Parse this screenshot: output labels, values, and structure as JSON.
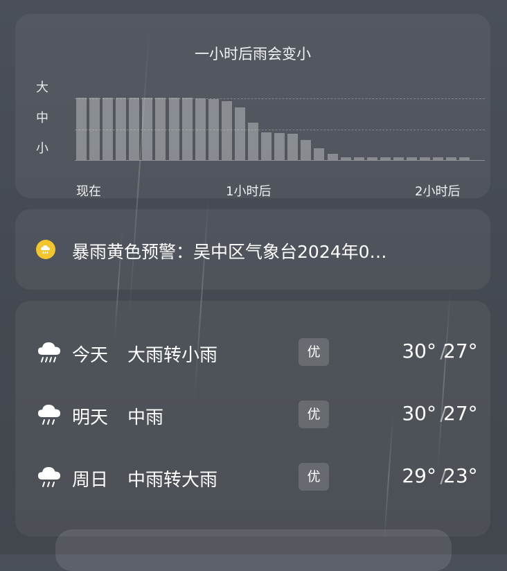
{
  "colors": {
    "background": "#474c54",
    "alert_icon": "#f3c62f",
    "bar": "rgba(255,255,255,0.32)"
  },
  "rain_card": {
    "title": "一小时后雨会变小",
    "levels": {
      "high": "大",
      "mid": "中",
      "low": "小"
    },
    "x_labels": {
      "now": "现在",
      "one_hour": "1小时后",
      "two_hours": "2小时后"
    }
  },
  "chart_data": {
    "type": "bar",
    "title": "一小时后雨会变小",
    "y_scale": [
      "小",
      "中",
      "大"
    ],
    "ylim": [
      0,
      3
    ],
    "x_tick_labels": [
      "现在",
      "1小时后",
      "2小时后"
    ],
    "values": [
      2.0,
      2.0,
      2.0,
      2.0,
      2.0,
      2.0,
      2.0,
      2.0,
      2.0,
      1.98,
      1.95,
      1.9,
      1.7,
      1.2,
      0.88,
      0.86,
      0.84,
      0.65,
      0.38,
      0.2,
      0.1,
      0.1,
      0.1,
      0.1,
      0.1,
      0.1,
      0.1,
      0.1,
      0.1,
      0.1
    ],
    "grid": true
  },
  "alert": {
    "icon": "storm-warning-icon",
    "text": "暴雨黄色预警：吴中区气象台2024年0…"
  },
  "forecast": [
    {
      "day": "今天",
      "condition": "大雨转小雨",
      "aqi": "优",
      "high": "30°",
      "low": "27°",
      "icon": "heavy-rain-cloud-icon"
    },
    {
      "day": "明天",
      "condition": "中雨",
      "aqi": "优",
      "high": "30°",
      "low": "27°",
      "icon": "rain-cloud-icon"
    },
    {
      "day": "周日",
      "condition": "中雨转大雨",
      "aqi": "优",
      "high": "29°",
      "low": "23°",
      "icon": "rain-cloud-icon"
    }
  ],
  "separator": "/"
}
